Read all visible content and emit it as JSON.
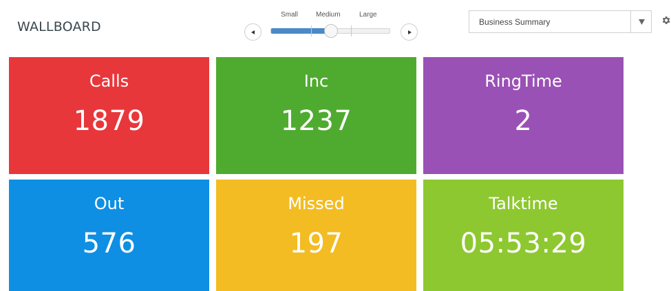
{
  "header": {
    "title": "WALLBOARD",
    "size_labels": [
      "Small",
      "Medium",
      "Large"
    ],
    "size_selected": "Medium",
    "selector": {
      "value": "Business Summary"
    },
    "icons": {
      "prev": "chevron-left-icon",
      "next": "chevron-right-icon",
      "dropdown": "caret-down-icon",
      "settings": "gear-icon"
    }
  },
  "tiles": [
    {
      "label": "Calls",
      "value": "1879",
      "color": "#e8373b"
    },
    {
      "label": "Inc",
      "value": "1237",
      "color": "#4fab30"
    },
    {
      "label": "RingTime",
      "value": "2",
      "color": "#9a51b5"
    },
    {
      "label": "Out",
      "value": "576",
      "color": "#0f8fe3"
    },
    {
      "label": "Missed",
      "value": "197",
      "color": "#f3bc22"
    },
    {
      "label": "Talktime",
      "value": "05:53:29",
      "color": "#8ec830"
    }
  ]
}
